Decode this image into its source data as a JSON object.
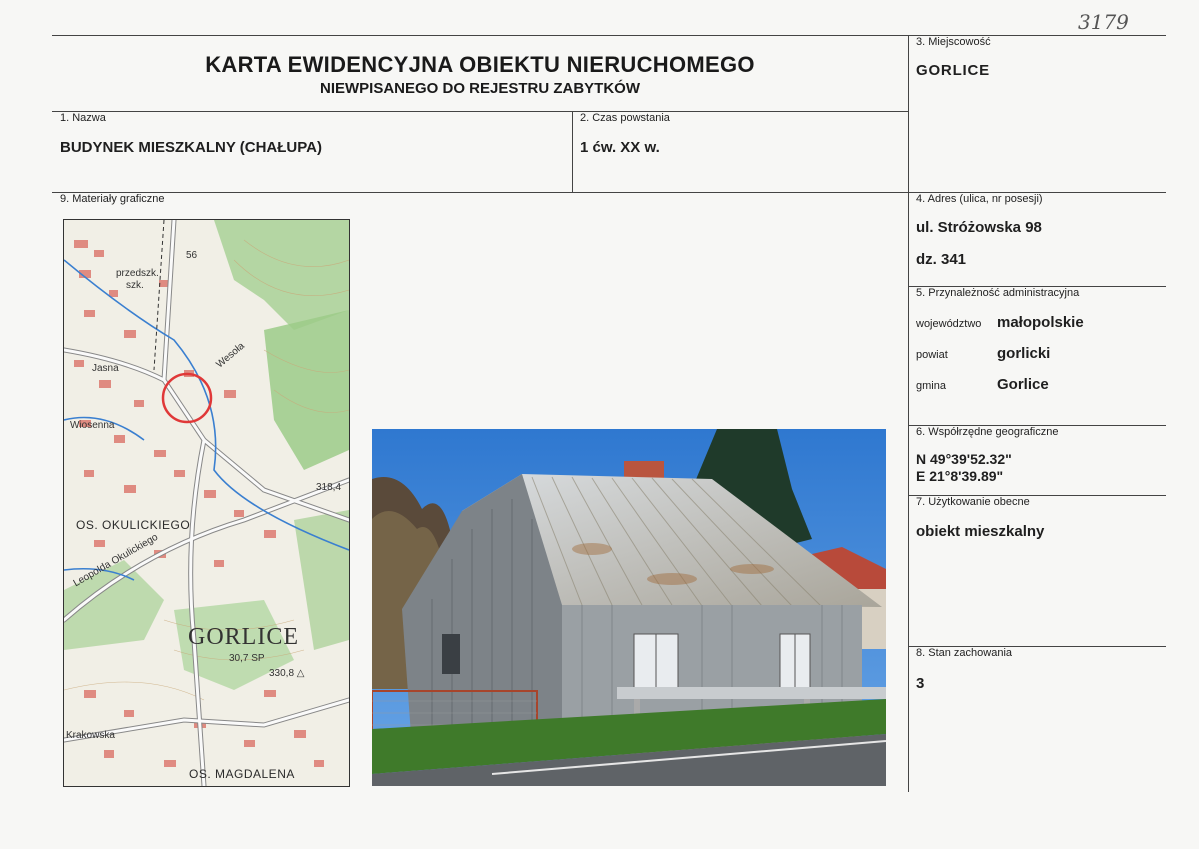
{
  "header": {
    "title_line1": "KARTA EWIDENCYJNA OBIEKTU NIERUCHOMEGO",
    "title_line2": "NIEWPISANEGO DO REJESTRU ZABYTKÓW",
    "archive_number": "3179"
  },
  "fields": {
    "nazwa": {
      "label": "1. Nazwa",
      "value": "BUDYNEK MIESZKALNY (CHAŁUPA)"
    },
    "czas": {
      "label": "2. Czas powstania",
      "value": "1 ćw. XX w."
    },
    "miejscowosc": {
      "label": "3. Miejscowość",
      "value": "GORLICE"
    },
    "adres": {
      "label": "4. Adres (ulica, nr posesji)",
      "value_street": "ul. Stróżowska 98",
      "value_parcel": "dz. 341"
    },
    "przynaleznosc": {
      "label": "5. Przynależność administracyjna",
      "wojewodztwo_label": "województwo",
      "wojewodztwo_value": "małopolskie",
      "powiat_label": "powiat",
      "powiat_value": "gorlicki",
      "gmina_label": "gmina",
      "gmina_value": "Gorlice"
    },
    "wspolrzedne": {
      "label": "6. Współrzędne geograficzne",
      "lat": "N 49°39'52.32\"",
      "lon": "E 21°8'39.89\""
    },
    "uzytkowanie": {
      "label": "7. Użytkowanie obecne",
      "value": "obiekt mieszkalny"
    },
    "stan": {
      "label": "8. Stan zachowania",
      "value": "3"
    },
    "materialy": {
      "label": "9. Materiały graficzne"
    }
  },
  "map": {
    "labels": {
      "town": "GORLICE",
      "okulickiego": "OS. OKULICKIEGO",
      "magdalena": "OS. MAGDALENA",
      "przedszk": "przedszk.",
      "szk": "szk.",
      "wiosenna": "Wiosenna",
      "leopolda": "Leopolda Okulickiego",
      "krakowska": "Krakowska",
      "jasna": "Jasna",
      "wesola": "Wesoła",
      "elev1": "318,4",
      "elev2": "330,8 △",
      "elev3": "30,7 SP",
      "n56": "56"
    },
    "colors": {
      "forest": "#9cc98a",
      "road": "#f2f2f2",
      "building": "#d85a5a",
      "water": "#3a7fd0",
      "marker": "#e03838"
    }
  },
  "photo": {
    "colors": {
      "sky": "#3d84d6",
      "roof": "#c7ccd0",
      "walls": "#8f959a",
      "grass": "#3f7a2a",
      "road": "#6a6e72"
    }
  }
}
